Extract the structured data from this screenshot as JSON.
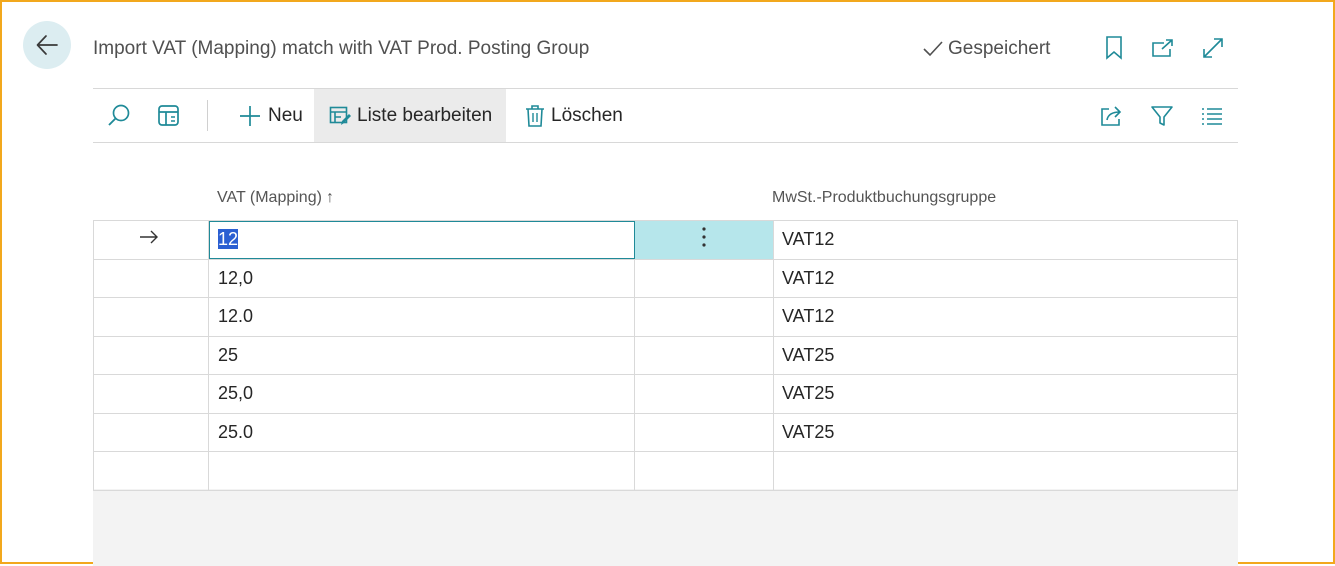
{
  "header": {
    "title": "Import VAT (Mapping) match with VAT Prod. Posting Group",
    "saved_label": "Gespeichert"
  },
  "toolbar": {
    "new_label": "Neu",
    "edit_list_label": "Liste bearbeiten",
    "delete_label": "Löschen"
  },
  "grid": {
    "columns": [
      "VAT (Mapping)",
      "MwSt.-Produktbuchungsgruppe"
    ],
    "sort_indicator": "↑",
    "rows": [
      {
        "mapping": "12",
        "group": "VAT12"
      },
      {
        "mapping": "12,0",
        "group": "VAT12"
      },
      {
        "mapping": "12.0",
        "group": "VAT12"
      },
      {
        "mapping": "25",
        "group": "VAT25"
      },
      {
        "mapping": "25,0",
        "group": "VAT25"
      },
      {
        "mapping": "25.0",
        "group": "VAT25"
      }
    ]
  },
  "colors": {
    "accent": "#1f8a98",
    "frame": "#f2a81d",
    "selection": "#2b5fd2"
  }
}
